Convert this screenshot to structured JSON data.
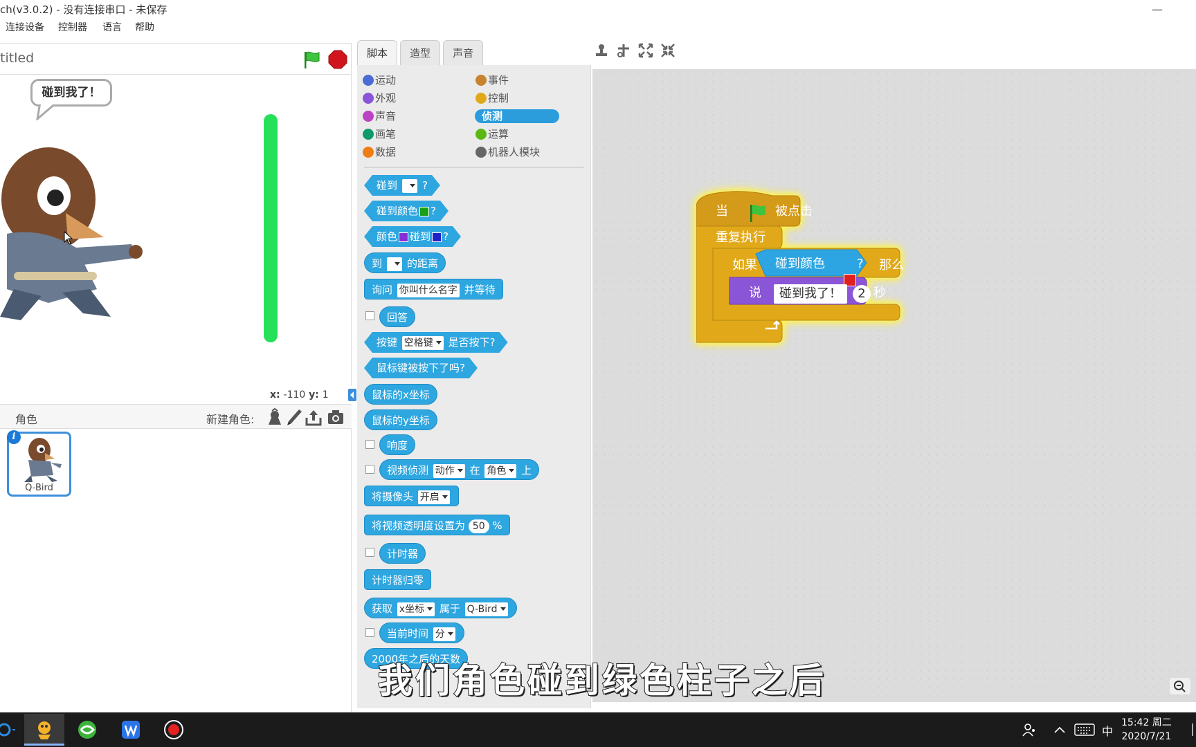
{
  "window": {
    "title": "ch(v3.0.2) - 没有连接串口 - 未保存",
    "minimize": "—"
  },
  "menu": [
    "连接设备",
    "控制器",
    "语言",
    "帮助"
  ],
  "stage": {
    "title": "titled",
    "speech": "碰到我了！",
    "coords": {
      "x_label": "x:",
      "x": "-110",
      "y_label": "y:",
      "y": "1"
    }
  },
  "sprites": {
    "header": "角色",
    "new_sprite": "新建角色:",
    "items": [
      {
        "name": "Q-Bird"
      }
    ],
    "info": "i"
  },
  "tabs": [
    "脚本",
    "造型",
    "声音"
  ],
  "categories": [
    {
      "label": "运动",
      "color": "#4a6cd4"
    },
    {
      "label": "事件",
      "color": "#c88330"
    },
    {
      "label": "外观",
      "color": "#8a55d7"
    },
    {
      "label": "控制",
      "color": "#e1a91a"
    },
    {
      "label": "声音",
      "color": "#bb42c3"
    },
    {
      "label": "侦测",
      "color": "#2ca5e2"
    },
    {
      "label": "画笔",
      "color": "#0e9a6c"
    },
    {
      "label": "运算",
      "color": "#5cb712"
    },
    {
      "label": "数据",
      "color": "#ee7d16"
    },
    {
      "label": "机器人模块",
      "color": "#666666"
    }
  ],
  "blocks": {
    "touching": "碰到",
    "q": "?",
    "touching_color": "碰到颜色",
    "color": "颜色",
    "color_touching": "碰到",
    "distance_to": "到",
    "distance_suffix": "的距离",
    "ask": "询问",
    "ask_default": "你叫什么名字",
    "ask_wait": "并等待",
    "answer": "回答",
    "key": "按键",
    "key_default": "空格键",
    "key_pressed": "是否按下?",
    "mouse_down": "鼠标键被按下了吗?",
    "mouse_x": "鼠标的x坐标",
    "mouse_y": "鼠标的y坐标",
    "loudness": "响度",
    "video_sense": "视频侦测",
    "video_motion": "动作",
    "video_on": "在",
    "video_sprite": "角色",
    "video_up": "上",
    "camera": "将摄像头",
    "camera_on": "开启",
    "video_transparency": "将视频透明度设置为",
    "transparency_value": "50",
    "percent": "%",
    "timer": "计时器",
    "reset_timer": "计时器归零",
    "get": "获取",
    "get_attr": "x坐标",
    "of": "属于",
    "of_sprite": "Q-Bird",
    "current_time": "当前时间",
    "time_unit": "分",
    "days_since": "2000年之后的天数"
  },
  "script": {
    "when": "当",
    "clicked": "被点击",
    "forever": "重复执行",
    "if": "如果",
    "touching_color": "碰到颜色",
    "q": "?",
    "then": "那么",
    "say": "说",
    "say_text": "碰到我了！",
    "say_secs": "2",
    "secs": "秒"
  },
  "subtitle": "我们角色碰到绿色柱子之后",
  "taskbar": {
    "input_method": "中",
    "time": "15:42 周二",
    "date": "2020/7/21"
  },
  "colors": {
    "sensing": "#2ea6e0",
    "control": "#e1a91a",
    "looks": "#8a55d7",
    "event": "#c88330",
    "red_swatch": "#e02020",
    "green_swatch": "#18a018",
    "purple_swatch": "#8a2bd8",
    "blue_swatch": "#2020c8"
  }
}
